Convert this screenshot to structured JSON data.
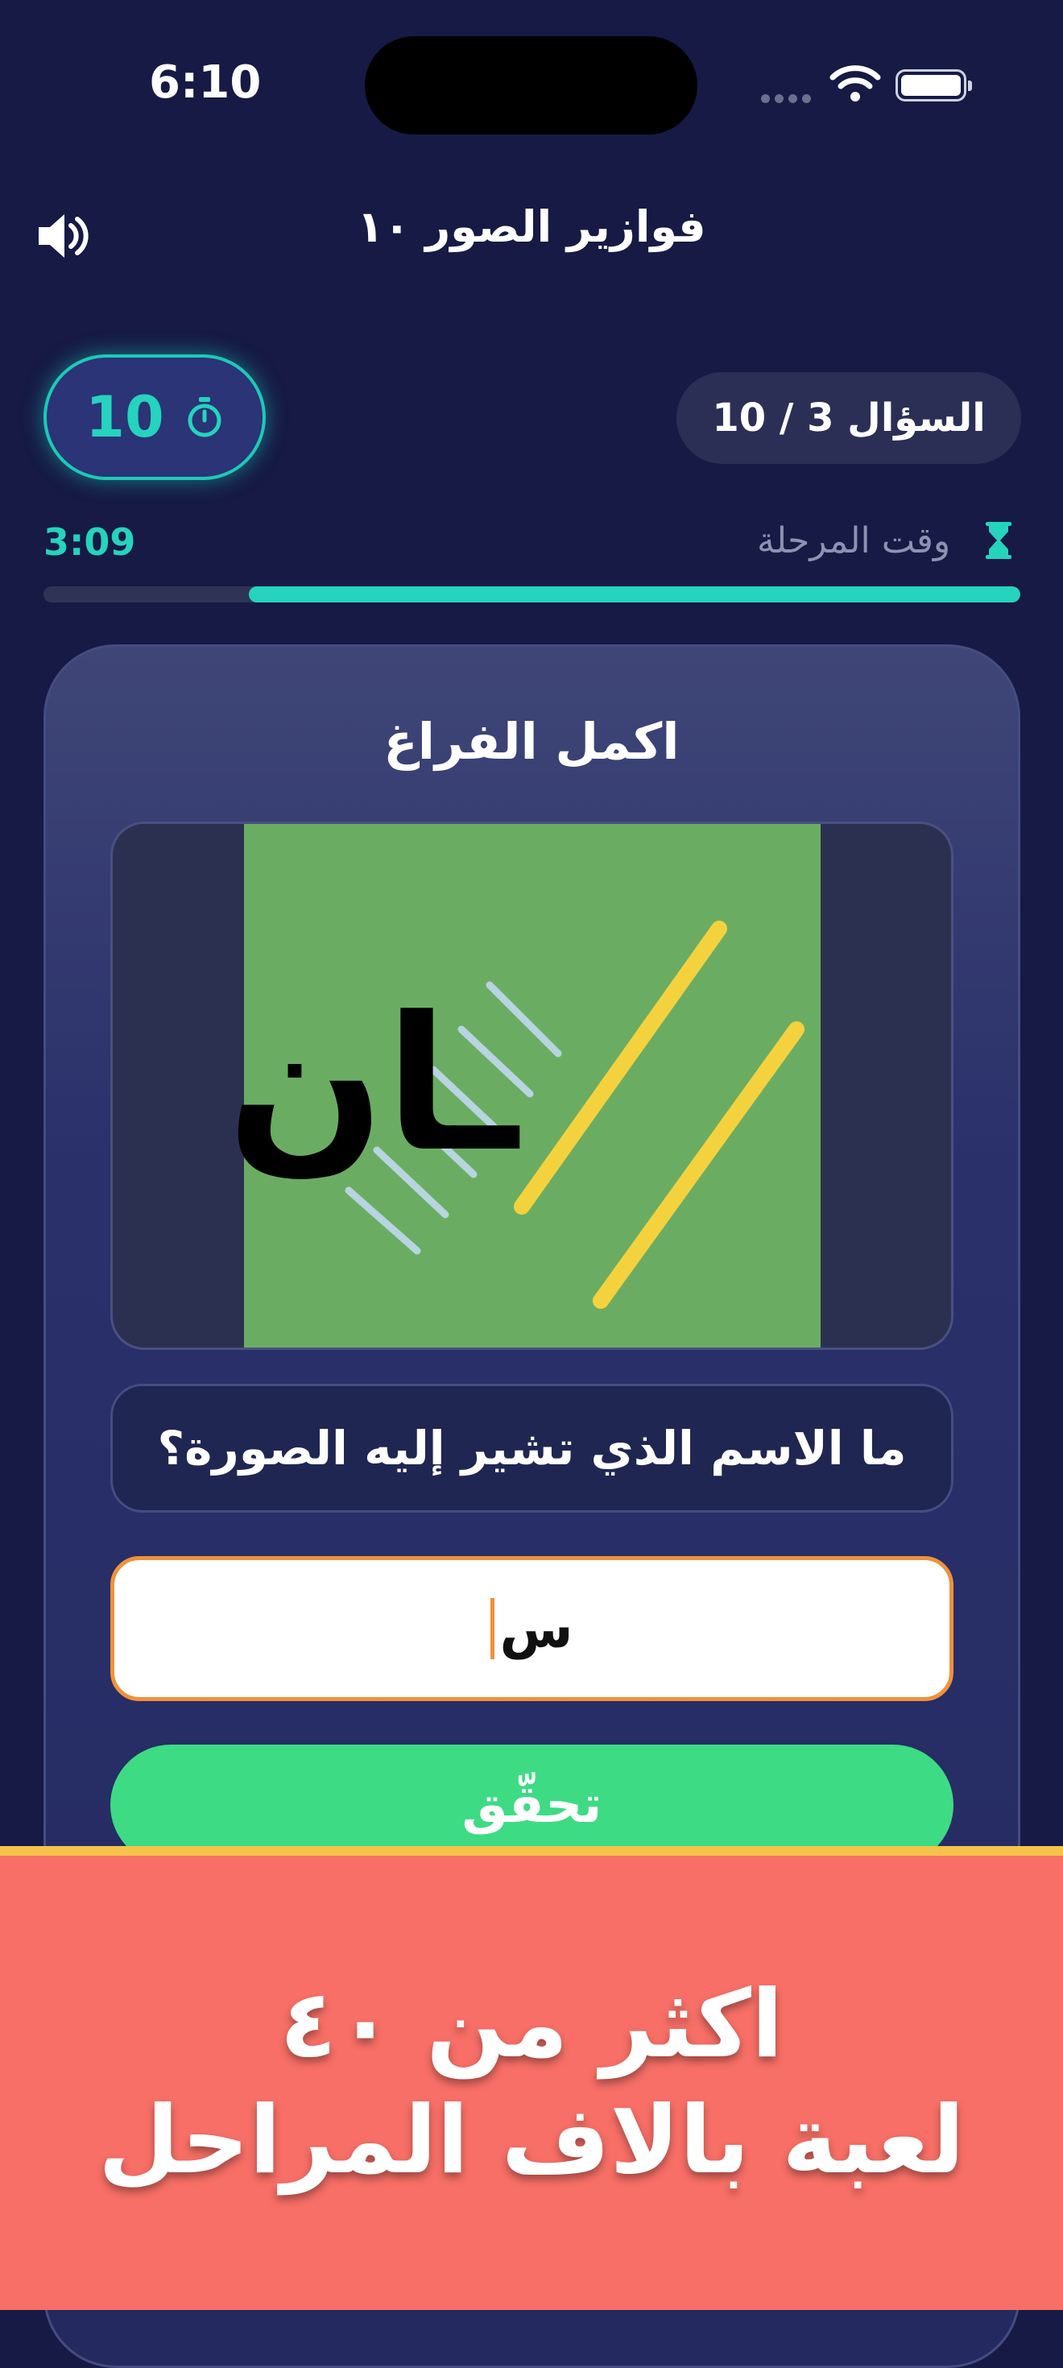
{
  "status_bar": {
    "time": "6:10"
  },
  "header": {
    "title": "فوازير الصور ١٠"
  },
  "timer": {
    "count": "10"
  },
  "question_counter": "السؤال 3 / 10",
  "stage": {
    "label": "وقت المرحلة",
    "time": "3:09",
    "progress": 0.79
  },
  "card": {
    "title": "اكمل الفراغ",
    "image_text": "ـان",
    "prompt": "ما الاسم الذي تشير إليه الصورة؟",
    "answer_value": "س",
    "check_label": "تحقّق"
  },
  "promo": {
    "line1": "اكثر من ٤٠",
    "line2": "لعبة بالاف المراحل"
  },
  "colors": {
    "background": "#161a45",
    "accent_teal": "#26d3bd",
    "check_green": "#3ddb84",
    "promo_red": "#f76f66",
    "input_border": "#f0913a"
  }
}
